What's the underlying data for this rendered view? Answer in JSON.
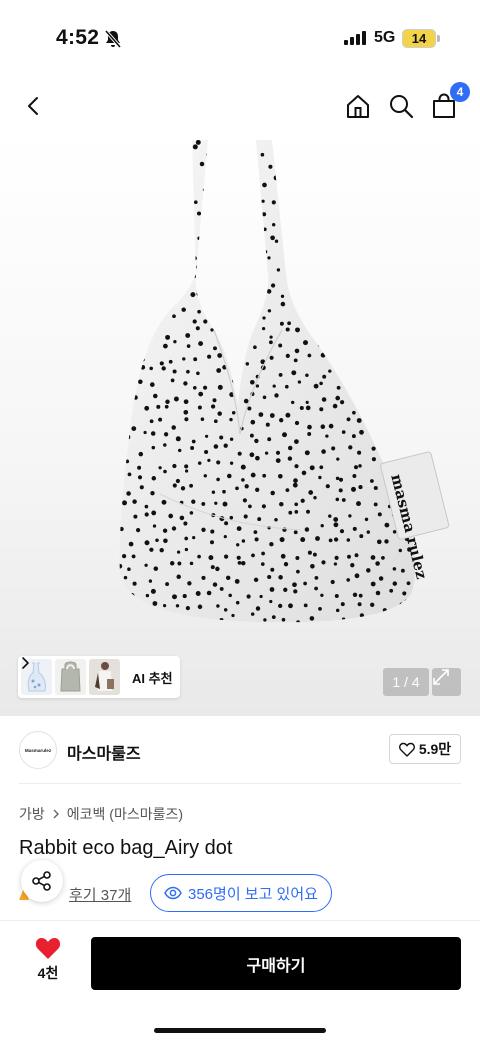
{
  "status_bar": {
    "time": "4:52",
    "network": "5G",
    "battery": "14"
  },
  "nav": {
    "cart_count": "4"
  },
  "gallery": {
    "ai_recommend_label": "AI 추천",
    "pager": "1 / 4",
    "tag_text": "masma rulez"
  },
  "brand": {
    "logo_text": "Masmarulez",
    "name": "마스마룰즈",
    "likes": "5.9만"
  },
  "breadcrumb": [
    "가방",
    "에코백 (마스마룰즈)"
  ],
  "product": {
    "title": "Rabbit eco bag_Airy dot",
    "reviews_label": "후기 37개",
    "viewers_label": "356명이 보고 있어요"
  },
  "bottom_bar": {
    "wish_count": "4천",
    "buy_label": "구매하기"
  },
  "colors": {
    "accent_blue": "#2f6df6",
    "heart_red": "#e8202f",
    "buy_black": "#000000",
    "battery_yellow": "#f3d34a"
  }
}
